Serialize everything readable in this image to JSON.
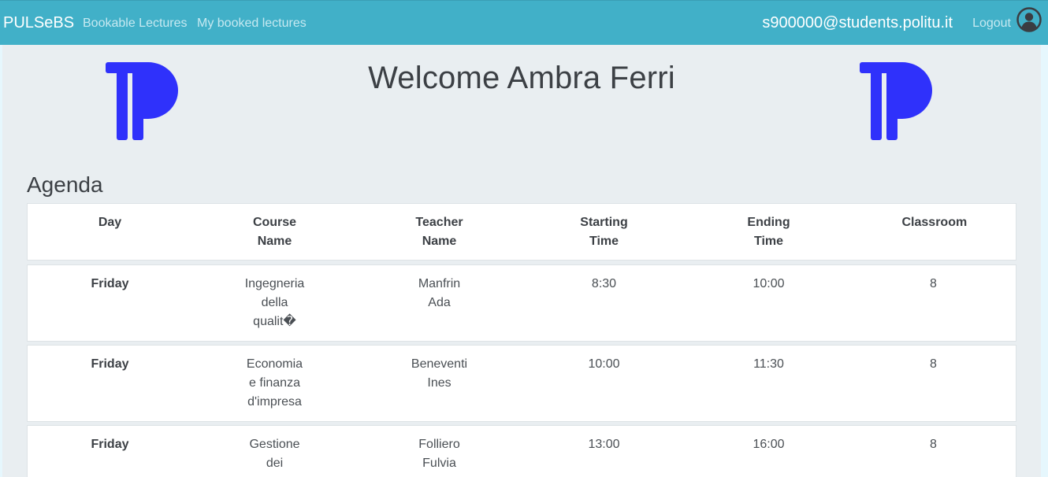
{
  "navbar": {
    "brand": "PULSeBS",
    "links": [
      "Bookable Lectures",
      "My booked lectures"
    ],
    "user_email": "s900000@students.politu.it",
    "logout_label": "Logout",
    "avatar_icon": "user-circle-icon"
  },
  "header": {
    "welcome": "Welcome Ambra Ferri",
    "logo_icon": "tp-logo-icon",
    "logo_color": "#2f31fb"
  },
  "agenda": {
    "title": "Agenda",
    "columns": [
      [
        "Day"
      ],
      [
        "Course",
        "Name"
      ],
      [
        "Teacher",
        "Name"
      ],
      [
        "Starting",
        "Time"
      ],
      [
        "Ending",
        "Time"
      ],
      [
        "Classroom"
      ]
    ],
    "rows": [
      {
        "day": "Friday",
        "course": [
          "Ingegneria",
          "della",
          "qualit�"
        ],
        "teacher": [
          "Manfrin",
          "Ada"
        ],
        "start": "8:30",
        "end": "10:00",
        "classroom": "8"
      },
      {
        "day": "Friday",
        "course": [
          "Economia",
          "e finanza",
          "d'impresa"
        ],
        "teacher": [
          "Beneventi",
          "Ines"
        ],
        "start": "10:00",
        "end": "11:30",
        "classroom": "8"
      },
      {
        "day": "Friday",
        "course": [
          "Gestione",
          "dei"
        ],
        "teacher": [
          "Folliero",
          "Fulvia"
        ],
        "start": "13:00",
        "end": "16:00",
        "classroom": "8"
      }
    ]
  },
  "colors": {
    "navbar": "#41b0c8",
    "page": "#e9eef1",
    "text": "#3c4045"
  }
}
